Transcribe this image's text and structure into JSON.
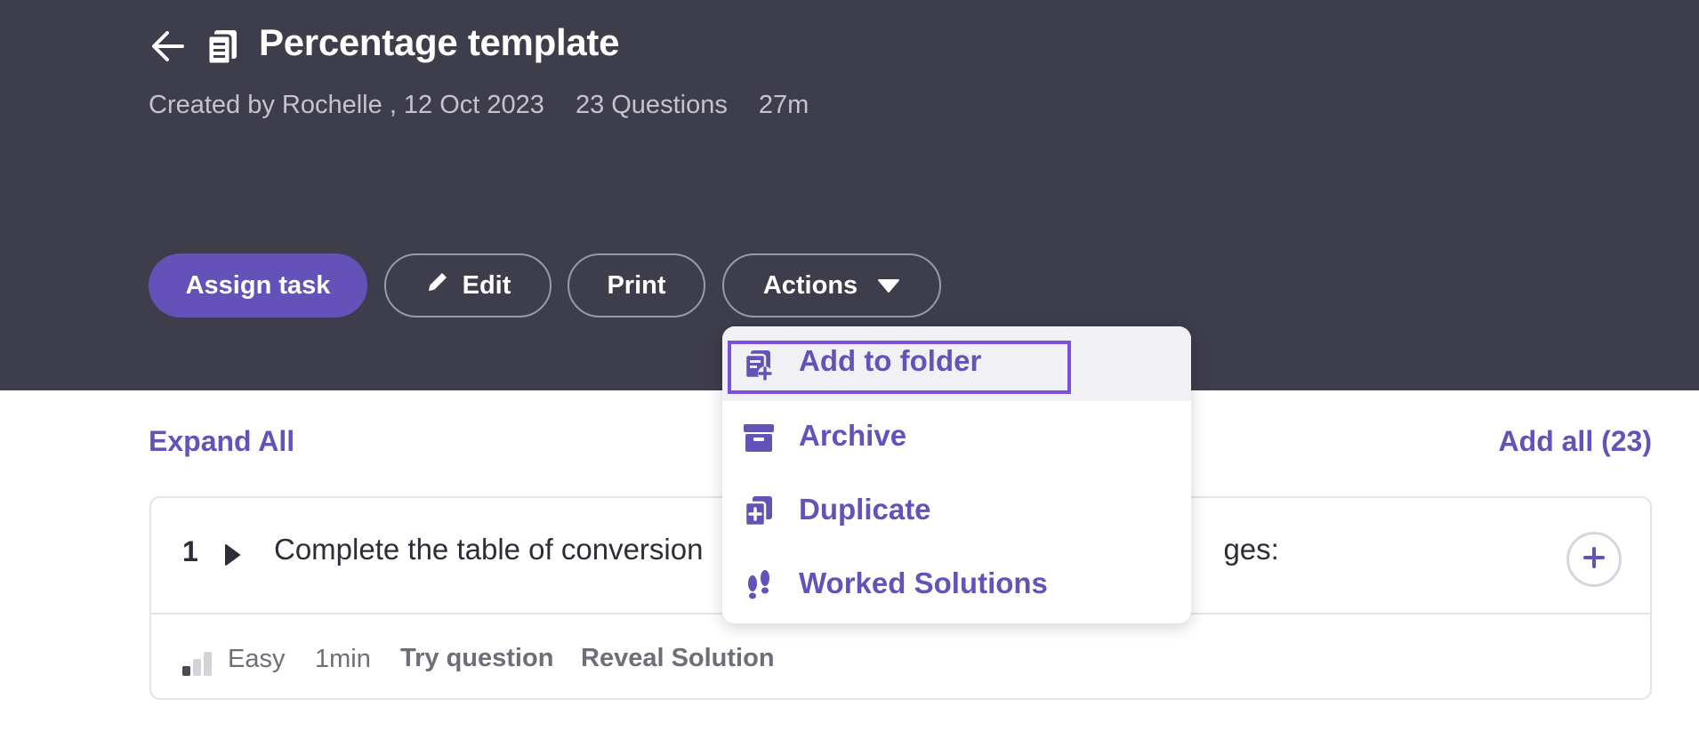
{
  "header": {
    "title": "Percentage template",
    "meta": {
      "created": "Created by Rochelle , 12 Oct 2023",
      "questions": "23 Questions",
      "duration": "27m"
    },
    "buttons": {
      "assign": "Assign task",
      "edit": "Edit",
      "print": "Print",
      "actions": "Actions"
    }
  },
  "actions_menu": {
    "items": [
      {
        "label": "Add to folder",
        "icon": "add-to-folder-icon",
        "focused": true
      },
      {
        "label": "Archive",
        "icon": "archive-icon"
      },
      {
        "label": "Duplicate",
        "icon": "duplicate-icon"
      },
      {
        "label": "Worked Solutions",
        "icon": "footprints-icon"
      }
    ]
  },
  "content": {
    "expand_all": "Expand All",
    "add_all": "Add all (23)"
  },
  "question": {
    "number": "1",
    "text_left": "Complete the table of conversion",
    "text_right": "ges:",
    "difficulty": "Easy",
    "difficulty_level": 1,
    "duration": "1min",
    "try_label": "Try question",
    "reveal_label": "Reveal Solution"
  },
  "colors": {
    "header_bg": "#3e3d4b",
    "accent": "#6552b8",
    "focus_outline": "#7b4fdc"
  }
}
